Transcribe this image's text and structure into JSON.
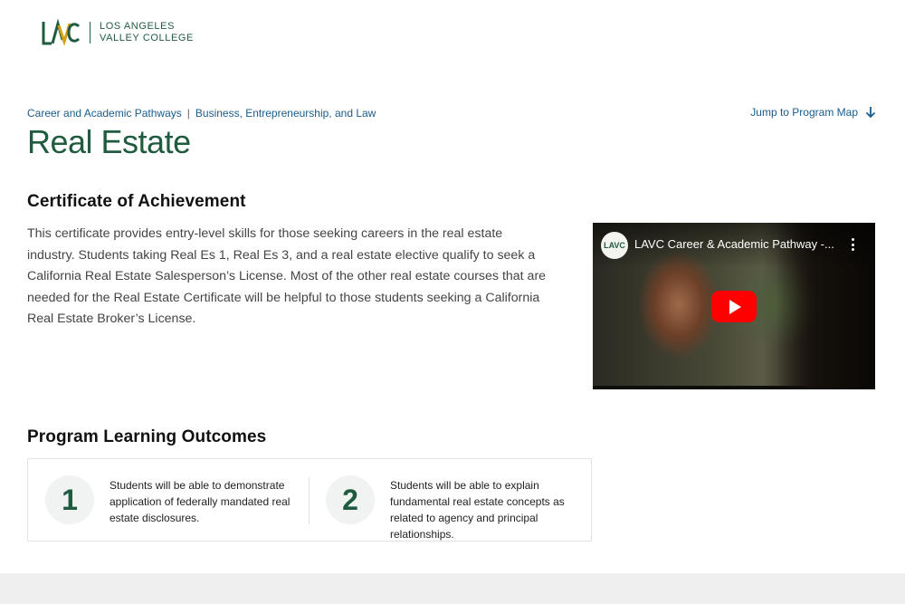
{
  "header": {
    "logo_mark": "LAVC",
    "logo_line1": "LOS ANGELES",
    "logo_line2": "VALLEY COLLEGE"
  },
  "breadcrumb": {
    "items": [
      "Career and Academic Pathways",
      "Business, Entrepreneurship, and Law"
    ],
    "separator": "|"
  },
  "jump_link": {
    "label": "Jump to Program Map",
    "icon": "arrow-down-icon"
  },
  "page": {
    "title": "Real Estate"
  },
  "certificate": {
    "heading": "Certificate of Achievement",
    "body": "This certificate provides entry-level skills for those seeking careers in the real estate industry. Students taking Real Es 1, Real Es 3, and a real estate elective qualify to seek a California Real Estate Salesperson’s License. Most of the other real estate courses that are needed for the Real Estate Certificate will be helpful to those students seeking a California Real Estate Broker’s License."
  },
  "video": {
    "channel_badge": "LAVC",
    "title": "LAVC Career & Academic Pathway -...",
    "play_color": "#ff0000"
  },
  "outcomes": {
    "heading": "Program Learning Outcomes",
    "items": [
      {
        "number": "1",
        "text": "Students will be able to demonstrate application of federally mandated real estate disclosures."
      },
      {
        "number": "2",
        "text": "Students will be able to explain fundamental real estate concepts as related to agency and principal relationships."
      }
    ]
  },
  "colors": {
    "brand_green": "#1f5b3f",
    "link_blue": "#1a5c8a",
    "logo_gold": "#d4a017"
  }
}
